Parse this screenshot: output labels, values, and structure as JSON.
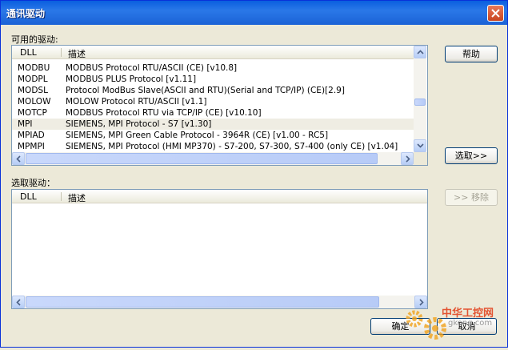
{
  "window": {
    "title": "通讯驱动"
  },
  "available": {
    "label": "可用的驱动:",
    "columns": {
      "dll": "DLL",
      "desc": "描述"
    },
    "rows": [
      {
        "dll": "MODBU",
        "desc": "MODBUS Protocol RTU/ASCII (CE) [v10.8]"
      },
      {
        "dll": "MODPL",
        "desc": "MODBUS PLUS Protocol  [v1.11]"
      },
      {
        "dll": "MODSL",
        "desc": "Protocol ModBus Slave(ASCII and RTU)(Serial and TCP/IP) (CE)[2.9]"
      },
      {
        "dll": "MOLOW",
        "desc": "MOLOW Protocol RTU/ASCII [v1.1]"
      },
      {
        "dll": "MOTCP",
        "desc": "MODBUS Protocol RTU via TCP/IP (CE) [v10.10]"
      },
      {
        "dll": "MPI",
        "desc": "SIEMENS, MPI Protocol - S7 [v1.30]",
        "selected": true
      },
      {
        "dll": "MPIAD",
        "desc": "SIEMENS, MPI Green Cable Protocol - 3964R (CE) [v1.00 - RC5]"
      },
      {
        "dll": "MPMPI",
        "desc": "SIEMENS, MPI Protocol (HMI MP370) - S7-200, S7-300, S7-400 (only CE) [v1.04]"
      }
    ]
  },
  "selected": {
    "label": "选取驱动：",
    "columns": {
      "dll": "DLL",
      "desc": "描述"
    }
  },
  "buttons": {
    "help": "帮助",
    "select": "选取>>",
    "remove": ">> 移除",
    "ok": "确定",
    "cancel": "取消"
  },
  "watermark": {
    "text1": "中华工控网",
    "text2": "gkong.com"
  }
}
